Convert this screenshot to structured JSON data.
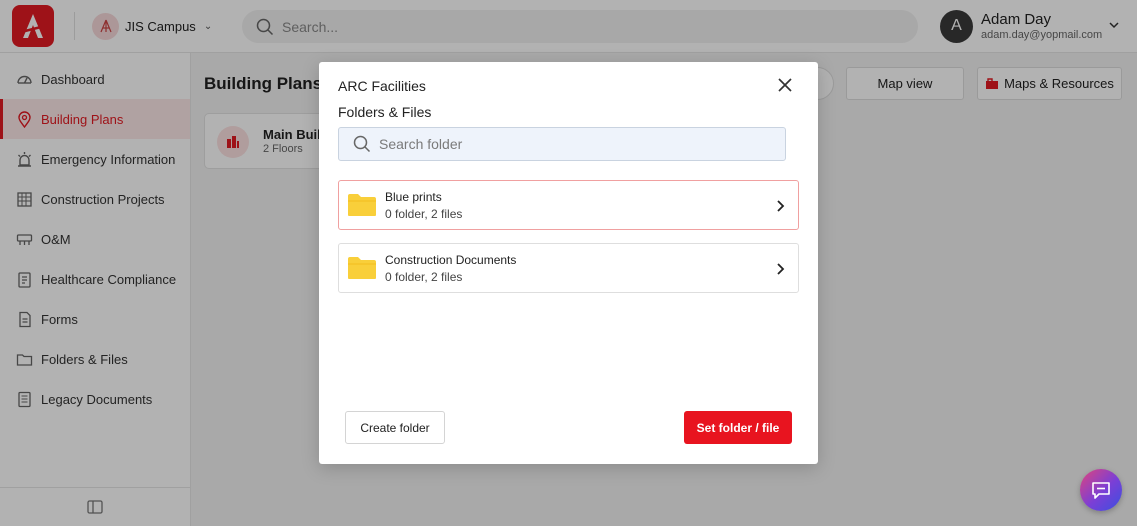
{
  "topbar": {
    "campus_label": "JIS Campus",
    "search_placeholder": "Search...",
    "user": {
      "initial": "A",
      "name": "Adam Day",
      "email": "adam.day@yopmail.com"
    }
  },
  "sidebar": {
    "items": [
      {
        "label": "Dashboard",
        "icon": "dashboard-icon",
        "active": false
      },
      {
        "label": "Building Plans",
        "icon": "location-pin-icon",
        "active": true
      },
      {
        "label": "Emergency Information",
        "icon": "alarm-icon",
        "active": false
      },
      {
        "label": "Construction Projects",
        "icon": "construction-icon",
        "active": false
      },
      {
        "label": "O&M",
        "icon": "maintenance-icon",
        "active": false
      },
      {
        "label": "Healthcare Compliance",
        "icon": "clipboard-icon",
        "active": false
      },
      {
        "label": "Forms",
        "icon": "form-icon",
        "active": false
      },
      {
        "label": "Folders & Files",
        "icon": "folder-icon",
        "active": false
      },
      {
        "label": "Legacy Documents",
        "icon": "documents-icon",
        "active": false
      }
    ]
  },
  "main": {
    "title": "Building Plans",
    "map_view_label": "Map view",
    "maps_resources_label": "Maps & Resources",
    "building_card": {
      "name": "Main Building",
      "sub": "2 Floors"
    }
  },
  "modal": {
    "title": "ARC Facilities",
    "subtitle": "Folders & Files",
    "search_placeholder": "Search folder",
    "folders": [
      {
        "name": "Blue prints",
        "meta": "0 folder, 2 files",
        "selected": true
      },
      {
        "name": "Construction Documents",
        "meta": "0 folder, 2 files",
        "selected": false
      }
    ],
    "create_label": "Create folder",
    "set_label": "Set folder / file"
  },
  "colors": {
    "brand": "#e31b23",
    "folder": "#f9cf3a",
    "selected_border": "#f0a0a0"
  }
}
